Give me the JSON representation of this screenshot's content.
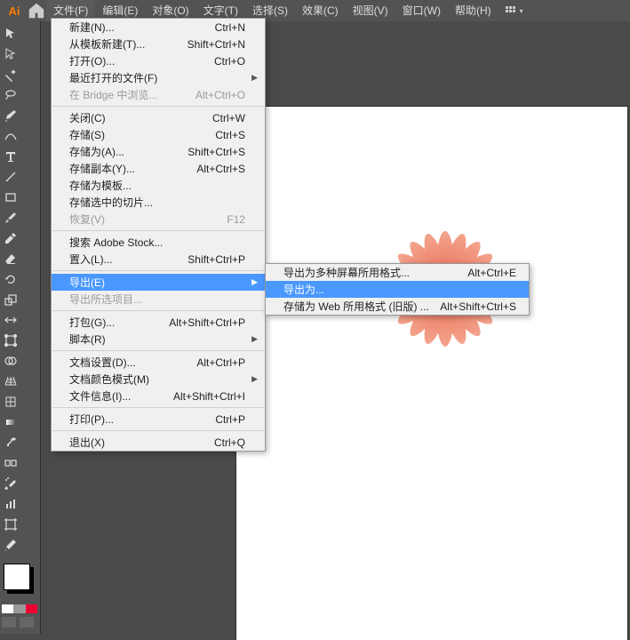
{
  "app": {
    "logo": "Ai"
  },
  "menubar": [
    "文件(F)",
    "编辑(E)",
    "对象(O)",
    "文字(T)",
    "选择(S)",
    "效果(C)",
    "视图(V)",
    "窗口(W)",
    "帮助(H)"
  ],
  "file_menu": [
    {
      "label": "新建(N)...",
      "sc": "Ctrl+N"
    },
    {
      "label": "从模板新建(T)...",
      "sc": "Shift+Ctrl+N"
    },
    {
      "label": "打开(O)...",
      "sc": "Ctrl+O"
    },
    {
      "label": "最近打开的文件(F)",
      "arrow": true
    },
    {
      "label": "在 Bridge 中浏览...",
      "sc": "Alt+Ctrl+O",
      "disabled": true
    },
    {
      "sep": true
    },
    {
      "label": "关闭(C)",
      "sc": "Ctrl+W"
    },
    {
      "label": "存储(S)",
      "sc": "Ctrl+S"
    },
    {
      "label": "存储为(A)...",
      "sc": "Shift+Ctrl+S"
    },
    {
      "label": "存储副本(Y)...",
      "sc": "Alt+Ctrl+S"
    },
    {
      "label": "存储为模板..."
    },
    {
      "label": "存储选中的切片..."
    },
    {
      "label": "恢复(V)",
      "sc": "F12",
      "disabled": true
    },
    {
      "sep": true
    },
    {
      "label": "搜索 Adobe Stock..."
    },
    {
      "label": "置入(L)...",
      "sc": "Shift+Ctrl+P"
    },
    {
      "sep": true
    },
    {
      "label": "导出(E)",
      "arrow": true,
      "highlight": true
    },
    {
      "label": "导出所选项目...",
      "disabled": true
    },
    {
      "sep": true
    },
    {
      "label": "打包(G)...",
      "sc": "Alt+Shift+Ctrl+P"
    },
    {
      "label": "脚本(R)",
      "arrow": true
    },
    {
      "sep": true
    },
    {
      "label": "文档设置(D)...",
      "sc": "Alt+Ctrl+P"
    },
    {
      "label": "文档颜色模式(M)",
      "arrow": true
    },
    {
      "label": "文件信息(I)...",
      "sc": "Alt+Shift+Ctrl+I"
    },
    {
      "sep": true
    },
    {
      "label": "打印(P)...",
      "sc": "Ctrl+P"
    },
    {
      "sep": true
    },
    {
      "label": "退出(X)",
      "sc": "Ctrl+Q"
    }
  ],
  "export_submenu": [
    {
      "label": "导出为多种屏幕所用格式...",
      "sc": "Alt+Ctrl+E"
    },
    {
      "label": "导出为...",
      "highlight": true
    },
    {
      "label": "存储为 Web 所用格式 (旧版) ...",
      "sc": "Alt+Shift+Ctrl+S"
    }
  ]
}
